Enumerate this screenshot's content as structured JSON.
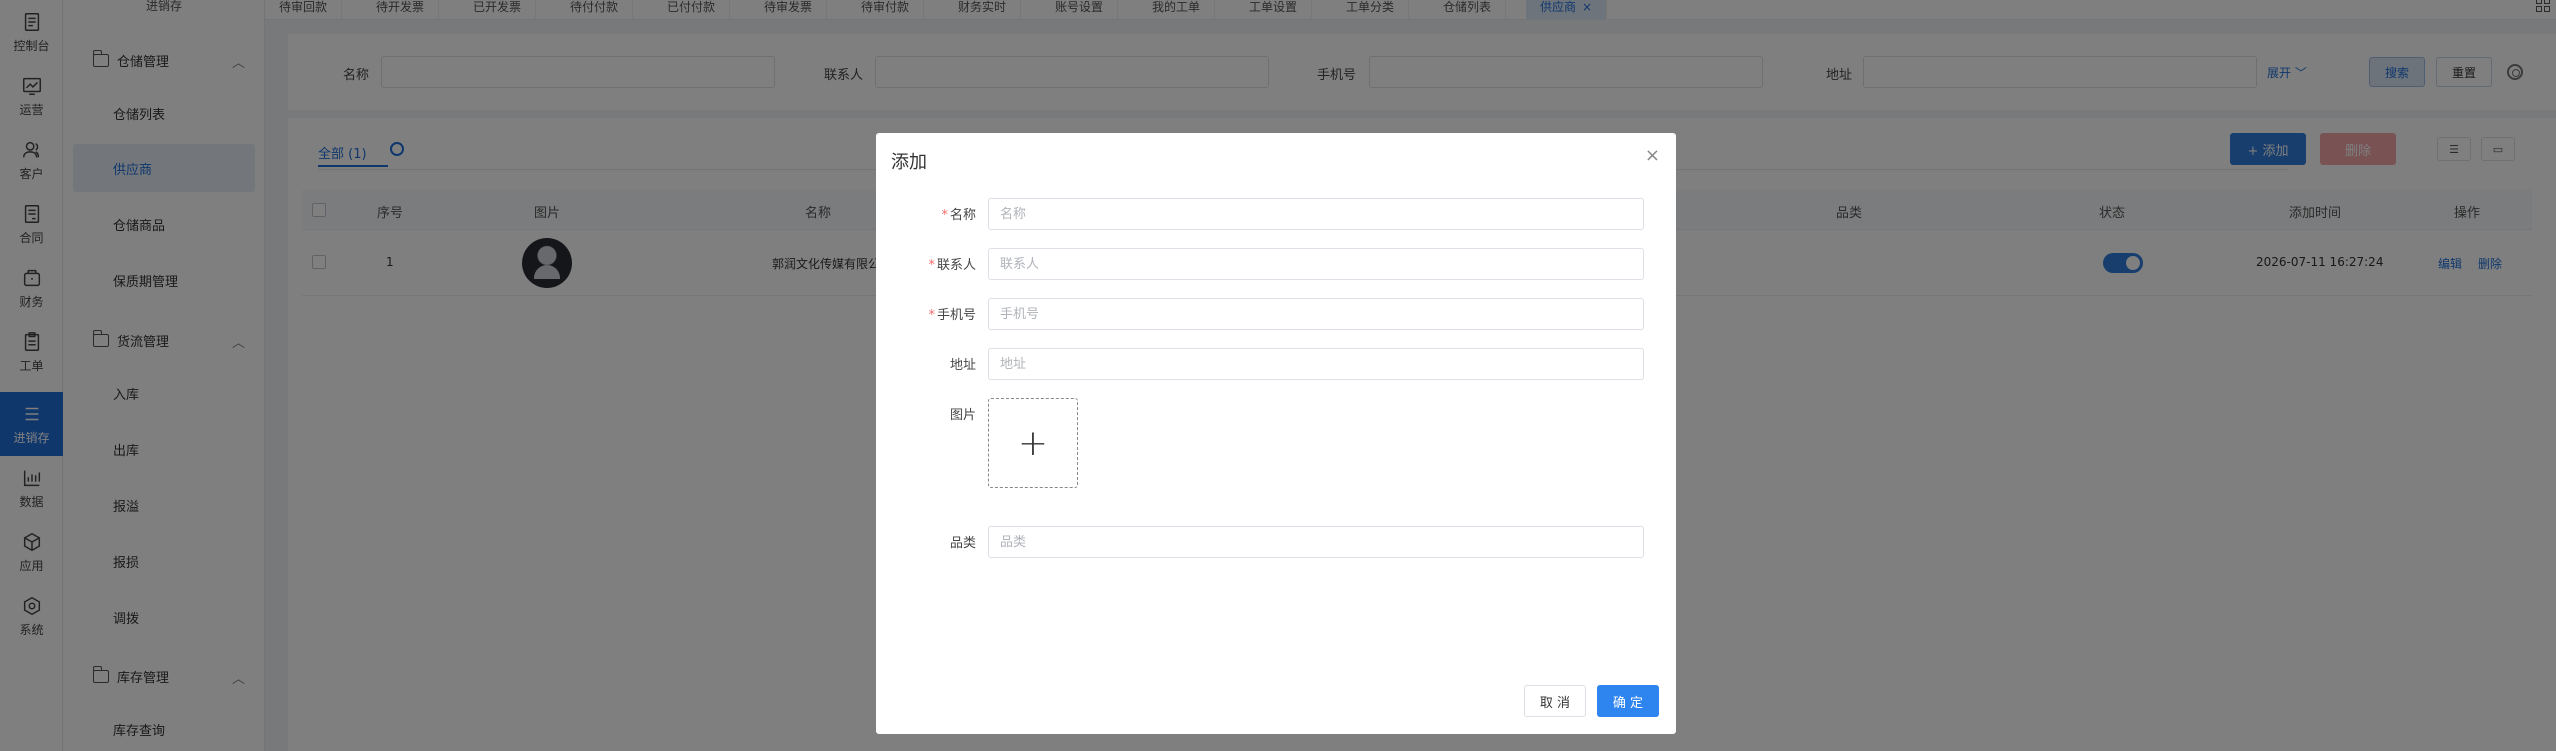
{
  "rail": [
    {
      "label": "控制台",
      "icon": "dashboard-icon"
    },
    {
      "label": "运营",
      "icon": "chart-icon"
    },
    {
      "label": "客户",
      "icon": "user-icon"
    },
    {
      "label": "合同",
      "icon": "contract-icon"
    },
    {
      "label": "财务",
      "icon": "wallet-icon"
    },
    {
      "label": "工单",
      "icon": "clipboard-icon"
    },
    {
      "label": "进销存",
      "icon": "menu-icon"
    },
    {
      "label": "数据",
      "icon": "bar-chart-icon"
    },
    {
      "label": "应用",
      "icon": "cube-icon"
    },
    {
      "label": "系统",
      "icon": "hexagon-icon"
    }
  ],
  "submenu": {
    "top_label": "进销存",
    "groups": [
      {
        "label": "仓储管理",
        "items": [
          "仓储列表",
          "供应商",
          "仓储商品",
          "保质期管理"
        ]
      },
      {
        "label": "货流管理",
        "items": [
          "入库",
          "出库",
          "报溢",
          "报损",
          "调拨"
        ]
      },
      {
        "label": "库存管理",
        "items": [
          "库存查询"
        ]
      }
    ]
  },
  "tabs": [
    "待审回款",
    "待开发票",
    "已开发票",
    "待付付款",
    "已付付款",
    "待审发票",
    "待审付款",
    "财务实时",
    "账号设置",
    "我的工单",
    "工单设置",
    "工单分类",
    "仓储列表",
    "供应商"
  ],
  "search": {
    "fields": [
      "名称",
      "联系人",
      "手机号",
      "地址"
    ],
    "expand": "展开",
    "search_btn": "搜索",
    "reset_btn": "重置"
  },
  "list": {
    "tab_label": "全部 (1)",
    "add_btn": "+ 添加",
    "delete_btn": "删除",
    "columns": [
      "序号",
      "图片",
      "名称",
      "品类",
      "状态",
      "添加时间",
      "操作"
    ],
    "rows": [
      {
        "index": "1",
        "name": "郭润文化传媒有限公司",
        "status_on": true,
        "time": "2026-07-11 16:27:24",
        "edit": "编辑",
        "delete": "删除"
      }
    ]
  },
  "modal": {
    "title": "添加",
    "fields": [
      {
        "label": "名称",
        "placeholder": "名称",
        "required": true
      },
      {
        "label": "联系人",
        "placeholder": "联系人",
        "required": true
      },
      {
        "label": "手机号",
        "placeholder": "手机号",
        "required": true
      },
      {
        "label": "地址",
        "placeholder": "地址",
        "required": false
      }
    ],
    "image_label": "图片",
    "category_label": "品类",
    "category_placeholder": "品类",
    "cancel": "取 消",
    "ok": "确 定"
  },
  "colors": {
    "accent": "#1e6fd9",
    "danger": "#f56c6c"
  }
}
